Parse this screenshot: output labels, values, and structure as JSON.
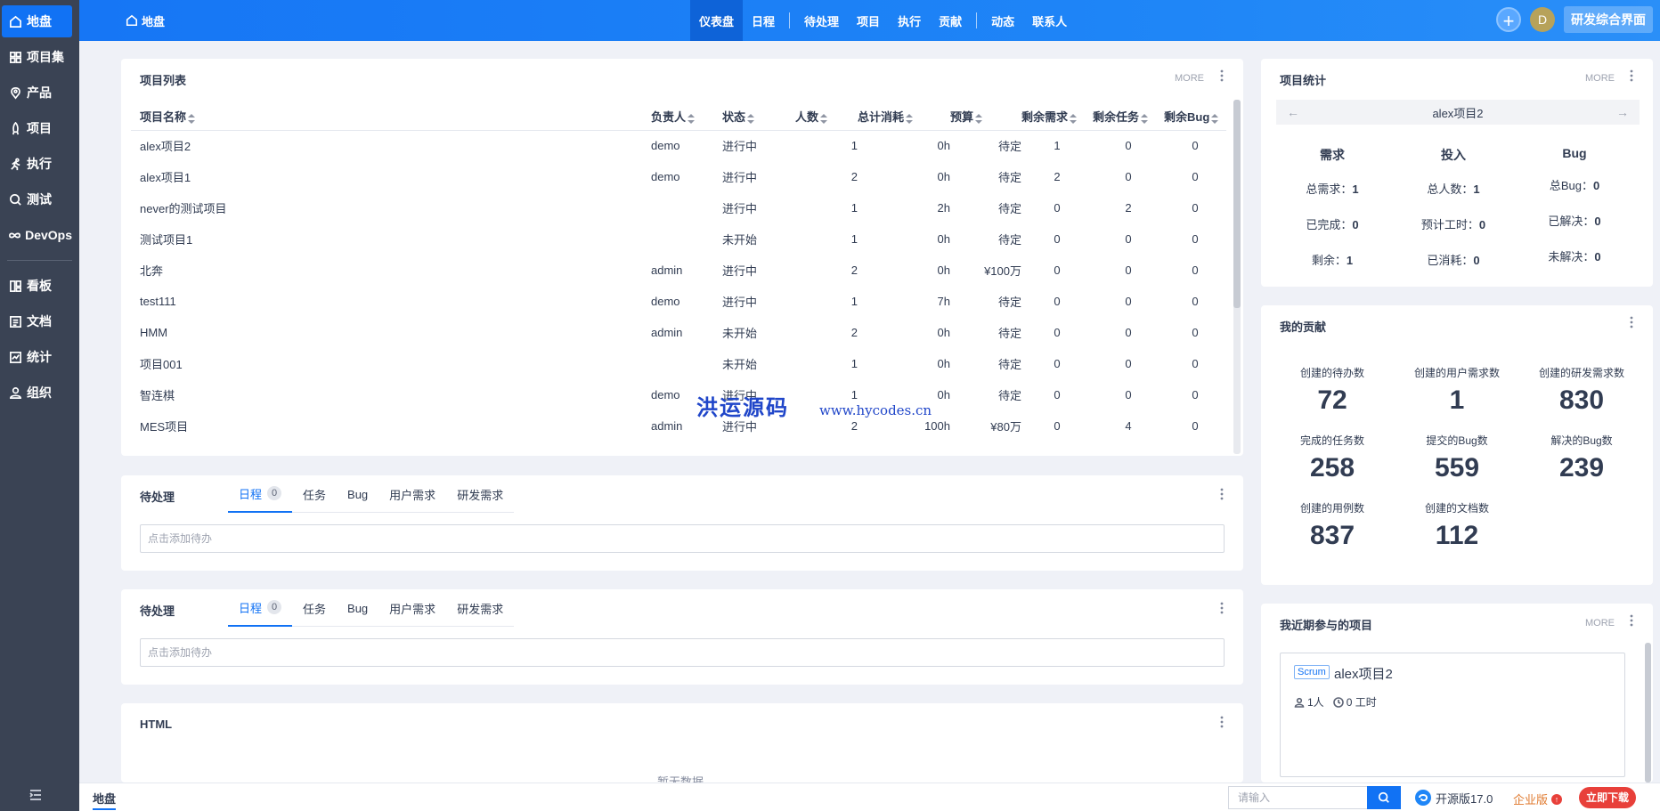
{
  "sidebar": {
    "items": [
      {
        "label": "地盘",
        "icon": "home-icon"
      },
      {
        "label": "项目集",
        "icon": "grid-icon"
      },
      {
        "label": "产品",
        "icon": "tag-icon"
      },
      {
        "label": "项目",
        "icon": "rocket-icon"
      },
      {
        "label": "执行",
        "icon": "run-icon"
      },
      {
        "label": "测试",
        "icon": "search-icon"
      },
      {
        "label": "DevOps",
        "icon": "infinity-icon"
      },
      {
        "label": "看板",
        "icon": "kanban-icon"
      },
      {
        "label": "文档",
        "icon": "doc-icon"
      },
      {
        "label": "统计",
        "icon": "chart-icon"
      },
      {
        "label": "组织",
        "icon": "user-icon"
      }
    ]
  },
  "header": {
    "crumb": "地盘",
    "nav": [
      "仪表盘",
      "日程",
      "待处理",
      "项目",
      "执行",
      "贡献",
      "动态",
      "联系人"
    ],
    "avatar": "D",
    "plus": "+",
    "switch_label": "研发综合界面"
  },
  "project_list": {
    "title": "项目列表",
    "more": "MORE",
    "columns": [
      "项目名称",
      "负责人",
      "状态",
      "人数",
      "总计消耗",
      "预算",
      "剩余需求",
      "剩余任务",
      "剩余Bug"
    ],
    "rows": [
      [
        "alex项目2",
        "demo",
        "进行中",
        "1",
        "0h",
        "待定",
        "1",
        "0",
        "0"
      ],
      [
        "alex项目1",
        "demo",
        "进行中",
        "2",
        "0h",
        "待定",
        "2",
        "0",
        "0"
      ],
      [
        "never的测试项目",
        "",
        "进行中",
        "1",
        "2h",
        "待定",
        "0",
        "2",
        "0"
      ],
      [
        "测试项目1",
        "",
        "未开始",
        "1",
        "0h",
        "待定",
        "0",
        "0",
        "0"
      ],
      [
        "北奔",
        "admin",
        "进行中",
        "2",
        "0h",
        "¥100万",
        "0",
        "0",
        "0"
      ],
      [
        "test111",
        "demo",
        "进行中",
        "1",
        "7h",
        "待定",
        "0",
        "0",
        "0"
      ],
      [
        "HMM",
        "admin",
        "未开始",
        "2",
        "0h",
        "待定",
        "0",
        "0",
        "0"
      ],
      [
        "项目001",
        "",
        "未开始",
        "1",
        "0h",
        "待定",
        "0",
        "0",
        "0"
      ],
      [
        "智连棋",
        "demo",
        "进行中",
        "1",
        "0h",
        "待定",
        "0",
        "0",
        "0"
      ],
      [
        "MES项目",
        "admin",
        "进行中",
        "2",
        "100h",
        "¥80万",
        "0",
        "4",
        "0"
      ]
    ]
  },
  "pending1": {
    "title": "待处理",
    "tabs": [
      "日程",
      "任务",
      "Bug",
      "用户需求",
      "研发需求"
    ],
    "count": "0",
    "placeholder": "点击添加待办"
  },
  "pending2": {
    "title": "待处理",
    "tabs": [
      "日程",
      "任务",
      "Bug",
      "用户需求",
      "研发需求"
    ],
    "count": "0",
    "placeholder": "点击添加待办"
  },
  "html_panel": {
    "title": "HTML",
    "empty": "暂无数据"
  },
  "project_stats": {
    "title": "项目统计",
    "more": "MORE",
    "current": "alex项目2",
    "prev": "←",
    "next": "→",
    "cols": [
      {
        "head": "需求",
        "lines": [
          [
            "总需求：",
            "1"
          ],
          [
            "已完成：",
            "0"
          ],
          [
            "剩余：",
            "1"
          ]
        ]
      },
      {
        "head": "投入",
        "lines": [
          [
            "总人数：",
            "1"
          ],
          [
            "预计工时：",
            "0"
          ],
          [
            "已消耗：",
            "0"
          ]
        ]
      },
      {
        "head": "Bug",
        "lines": [
          [
            "总Bug：",
            "0"
          ],
          [
            "已解决：",
            "0"
          ],
          [
            "未解决：",
            "0"
          ]
        ]
      }
    ]
  },
  "contribution": {
    "title": "我的贡献",
    "items": [
      {
        "label": "创建的待办数",
        "value": "72"
      },
      {
        "label": "创建的用户需求数",
        "value": "1"
      },
      {
        "label": "创建的研发需求数",
        "value": "830"
      },
      {
        "label": "完成的任务数",
        "value": "258"
      },
      {
        "label": "提交的Bug数",
        "value": "559"
      },
      {
        "label": "解决的Bug数",
        "value": "239"
      },
      {
        "label": "创建的用例数",
        "value": "837"
      },
      {
        "label": "创建的文档数",
        "value": "112"
      }
    ]
  },
  "recent": {
    "title": "我近期参与的项目",
    "more": "MORE",
    "tag": "Scrum",
    "name": "alex项目2",
    "members": "1人",
    "hours": "0 工时"
  },
  "footer": {
    "crumb": "地盘",
    "search_placeholder": "请输入",
    "version": "开源版17.0",
    "enterprise": "企业版",
    "download": "立即下载"
  },
  "watermark": {
    "cn": "洪运源码",
    "url": "www.hycodes.cn"
  },
  "colors": {
    "accent": "#1172f4",
    "sidebar": "#3a4354",
    "running": "#e8403a",
    "waiting": "#838a9d"
  }
}
